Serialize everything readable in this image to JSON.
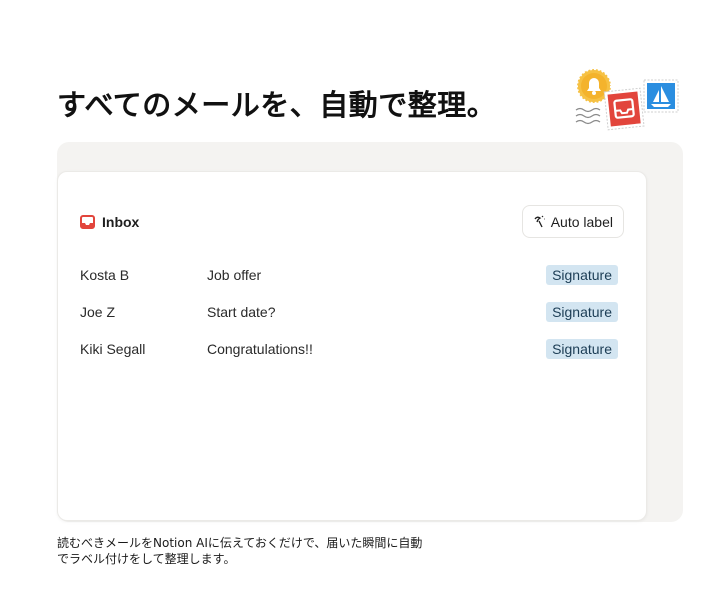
{
  "headline": "すべてのメールを、自動で整理。",
  "inbox": {
    "title": "Inbox",
    "auto_label_button": "Auto label",
    "emails": [
      {
        "sender": "Kosta B",
        "subject": "Job offer",
        "tag": "Signature"
      },
      {
        "sender": "Joe Z",
        "subject": "Start date?",
        "tag": "Signature"
      },
      {
        "sender": "Kiki Segall",
        "subject": "Congratulations!!",
        "tag": "Signature"
      }
    ]
  },
  "caption": {
    "line1": "読むべきメールをNotion AIに伝えておくだけで、届いた瞬間に自動",
    "line2": "でラベル付けをして整理します。"
  },
  "colors": {
    "inbox_icon": "#e2453c",
    "tag_bg": "#d3e5f1",
    "panel_bg": "#f4f3f1"
  },
  "icons": [
    "bell-stamp-icon",
    "inbox-stamp-icon",
    "sailboat-stamp-icon",
    "inbox-icon",
    "auto-label-icon"
  ]
}
